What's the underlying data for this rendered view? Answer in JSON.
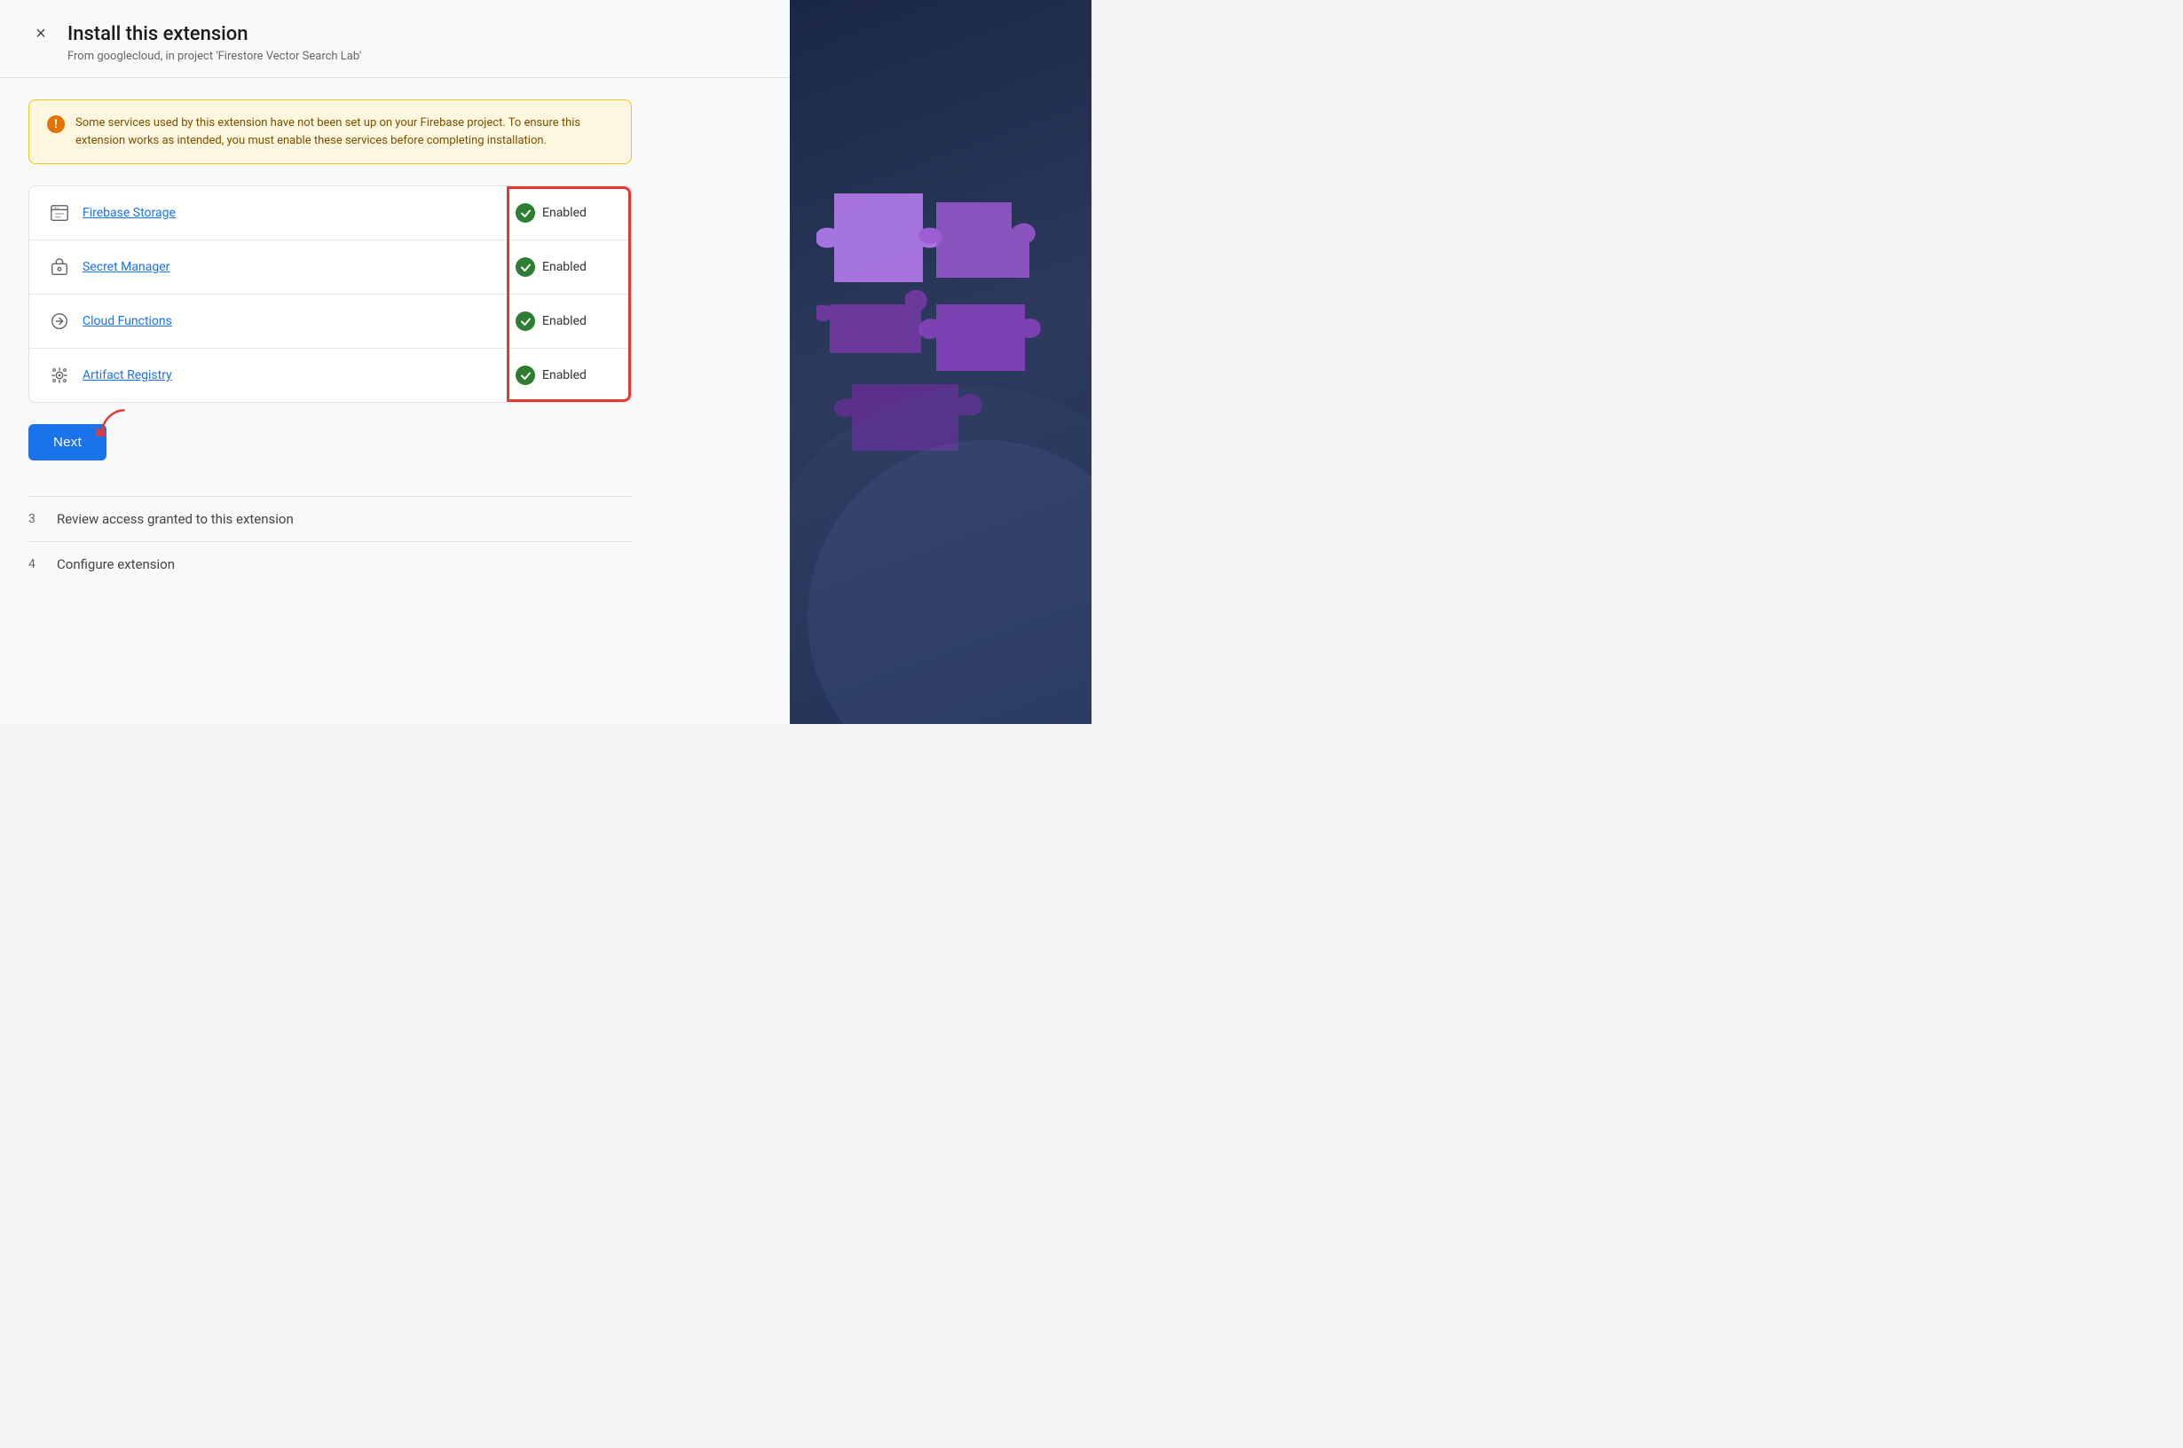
{
  "header": {
    "title": "Install this extension",
    "subtitle": "From googlecloud, in project 'Firestore Vector Search Lab'",
    "close_label": "×"
  },
  "warning": {
    "message": "Some services used by this extension have not been set up on your Firebase project. To ensure this extension works as intended, you must enable these services before completing installation."
  },
  "services": [
    {
      "name": "Firebase Storage",
      "status": "Enabled",
      "icon": "🖼"
    },
    {
      "name": "Secret Manager",
      "status": "Enabled",
      "icon": "🔑"
    },
    {
      "name": "Cloud Functions",
      "status": "Enabled",
      "icon": "⚙"
    },
    {
      "name": "Artifact Registry",
      "status": "Enabled",
      "icon": "📦"
    }
  ],
  "buttons": {
    "next": "Next"
  },
  "steps": [
    {
      "number": "3",
      "label": "Review access granted to this extension"
    },
    {
      "number": "4",
      "label": "Configure extension"
    }
  ]
}
